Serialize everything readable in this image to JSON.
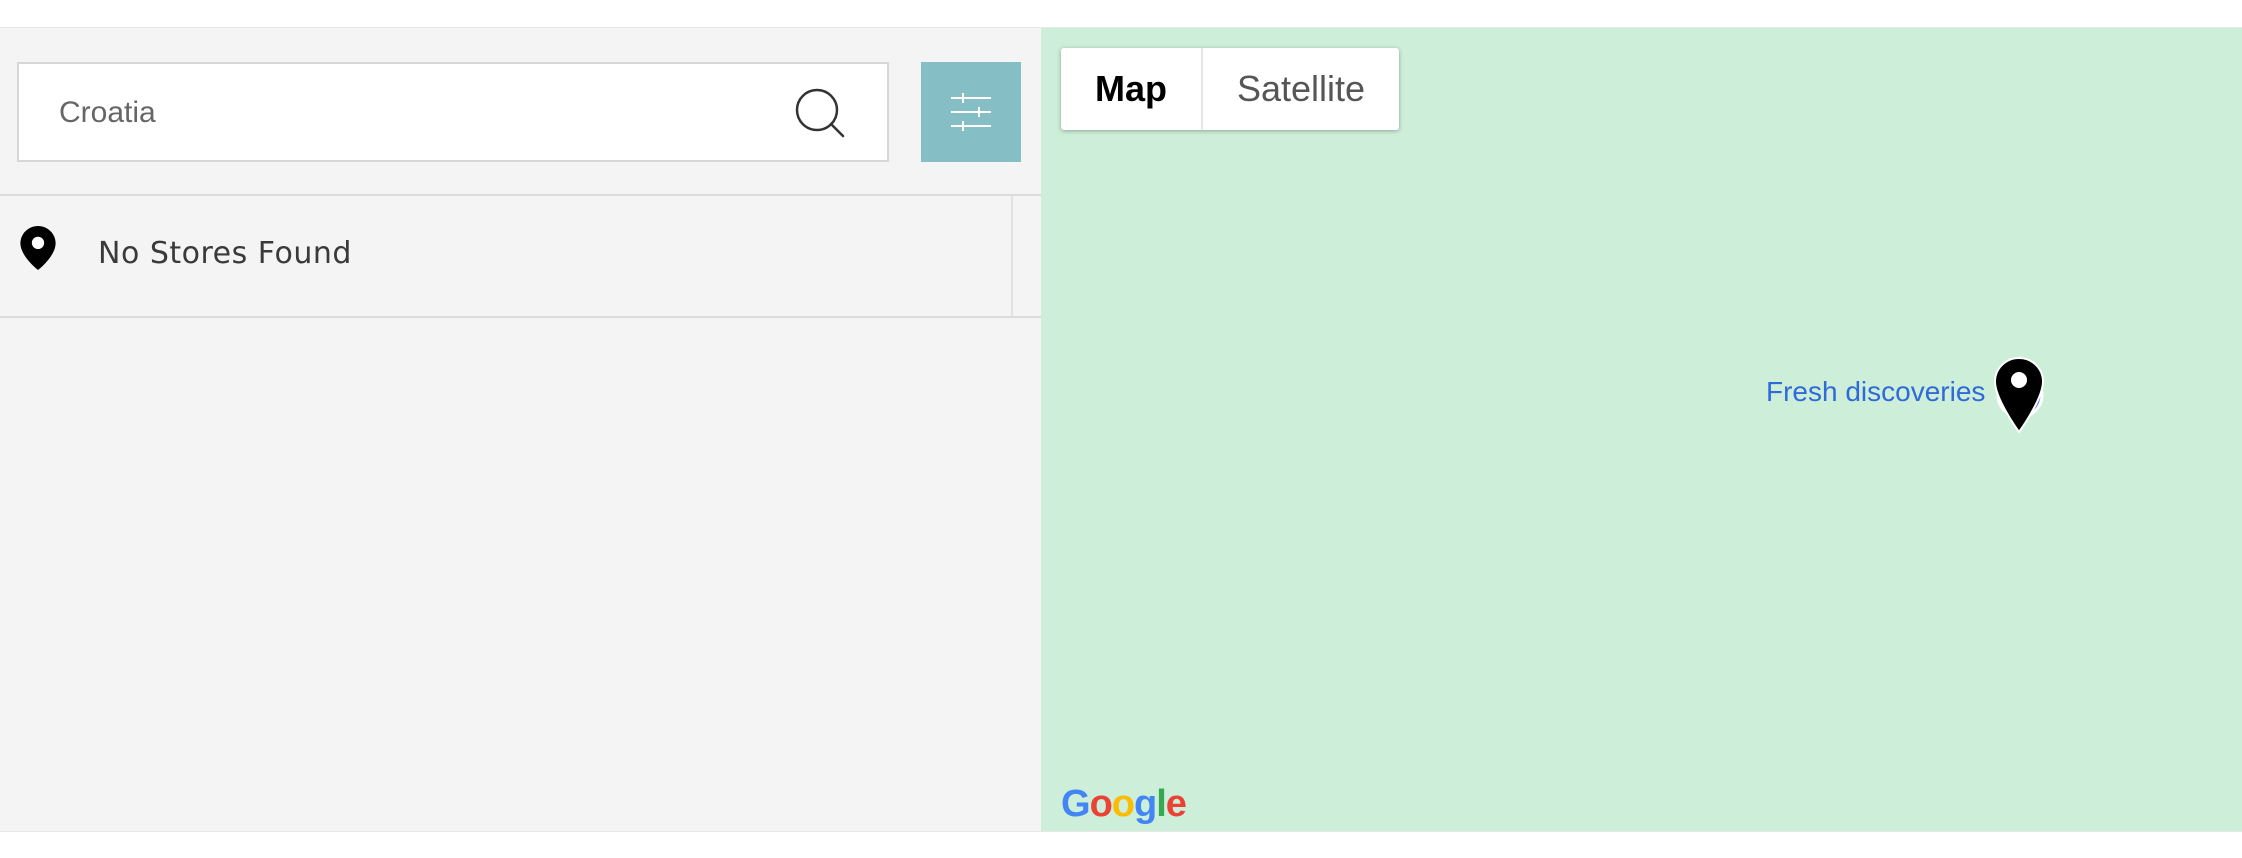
{
  "search": {
    "value": "Croatia",
    "search_icon": "search-icon",
    "filter_icon": "sliders-icon",
    "filter_color": "#86bec6"
  },
  "results": {
    "icon": "map-pin-icon",
    "message": "No Stores Found"
  },
  "map": {
    "background_color": "#cdeed8",
    "map_type_control": {
      "options": [
        "Map",
        "Satellite"
      ],
      "selected": "Map"
    },
    "poi_label": "Fresh discoveries",
    "poi_label_color": "#2f6ad8",
    "marker_icon": "map-marker-icon",
    "attribution_logo": [
      "G",
      "o",
      "o",
      "g",
      "l",
      "e"
    ]
  }
}
